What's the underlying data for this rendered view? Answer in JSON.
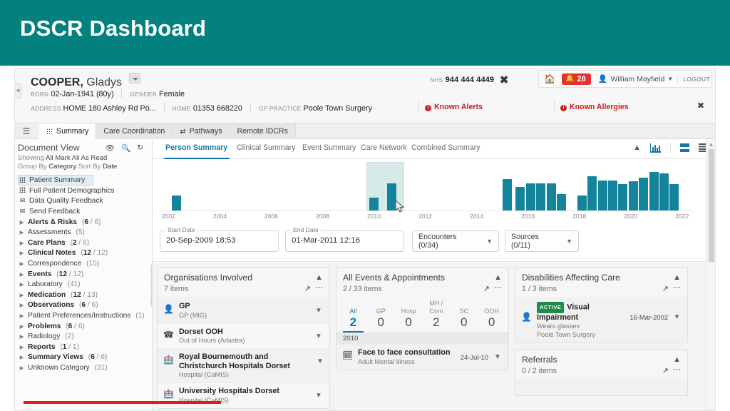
{
  "banner": {
    "title": "DSCR Dashboard",
    "bg": "#04817f"
  },
  "patient": {
    "surname": "COOPER,",
    "given": "Gladys",
    "born_label": "BORN",
    "born_value": "02-Jan-1941 (80y)",
    "gender_label": "GENDER",
    "gender_value": "Female",
    "address_label": "ADDRESS",
    "address_value": "HOME 180 Ashley Rd Po...",
    "home_label": "HOME",
    "home_value": "01353 668220",
    "gp_practice_label": "GP PRACTICE",
    "gp_practice_value": "Poole Town Surgery",
    "nhs_label": "NHS",
    "nhs_value": "944 444 4449",
    "known_alerts": "Known Alerts",
    "known_allergies": "Known Allergies",
    "alert_color": "#c9201a"
  },
  "account": {
    "alert_count": "28",
    "user_name": "William Mayfield",
    "logout": "LOGOUT",
    "alert_bg": "#e8312a"
  },
  "main_tabs": [
    {
      "label": "Summary",
      "icon": "grid-icon",
      "active": true
    },
    {
      "label": "Care Coordination",
      "icon": "",
      "active": false
    },
    {
      "label": "Pathways",
      "icon": "pathways-icon",
      "active": false
    },
    {
      "label": "Remote IDCRs",
      "icon": "",
      "active": false
    }
  ],
  "sidebar": {
    "title": "Document View",
    "icons": [
      "eye-icon",
      "search-icon",
      "refresh-icon"
    ],
    "showing_label": "Showing",
    "showing_value": "All",
    "mark_all": "Mark All As Read",
    "group_by_label": "Group By",
    "group_by_value": "Category",
    "sort_by_label": "Sort By",
    "sort_by_value": "Date",
    "items": [
      {
        "label": "Patient Summary",
        "icon": "grid-icon",
        "count": "",
        "bold": false,
        "selected": true
      },
      {
        "label": "Full Patient Demographics",
        "icon": "grid-icon",
        "count": "",
        "bold": false,
        "selected": false
      },
      {
        "label": "Data Quality Feedback",
        "icon": "envelope-icon",
        "count": "",
        "bold": false,
        "selected": false
      },
      {
        "label": "Send Feedback",
        "icon": "envelope-icon",
        "count": "",
        "bold": false,
        "selected": false
      },
      {
        "label": "Alerts & Risks",
        "icon": "triangle-icon",
        "count": "(6 / 6)",
        "unread": "6",
        "total": "6",
        "bold": true,
        "selected": false
      },
      {
        "label": "Assessments",
        "icon": "triangle-icon",
        "count": "(5)",
        "bold": false,
        "selected": false
      },
      {
        "label": "Care Plans",
        "icon": "triangle-icon",
        "count": "(2 / 6)",
        "unread": "2",
        "total": "6",
        "bold": true,
        "selected": false
      },
      {
        "label": "Clinical Notes",
        "icon": "triangle-icon",
        "count": "(12 / 12)",
        "unread": "12",
        "total": "12",
        "bold": true,
        "selected": false
      },
      {
        "label": "Correspondence",
        "icon": "triangle-icon",
        "count": "(15)",
        "bold": false,
        "selected": false
      },
      {
        "label": "Events",
        "icon": "triangle-icon",
        "count": "(12 / 12)",
        "unread": "12",
        "total": "12",
        "bold": true,
        "selected": false
      },
      {
        "label": "Laboratory",
        "icon": "triangle-icon",
        "count": "(41)",
        "bold": false,
        "selected": false
      },
      {
        "label": "Medication",
        "icon": "triangle-icon",
        "count": "(12 / 13)",
        "unread": "12",
        "total": "13",
        "bold": true,
        "selected": false
      },
      {
        "label": "Observations",
        "icon": "triangle-icon",
        "count": "(6 / 6)",
        "unread": "6",
        "total": "6",
        "bold": true,
        "selected": false
      },
      {
        "label": "Patient Preferences/Instructions",
        "icon": "triangle-icon",
        "count": "(1)",
        "bold": false,
        "selected": false
      },
      {
        "label": "Problems",
        "icon": "triangle-icon",
        "count": "(6 / 6)",
        "unread": "6",
        "total": "6",
        "bold": true,
        "selected": false
      },
      {
        "label": "Radiology",
        "icon": "triangle-icon",
        "count": "(2)",
        "bold": false,
        "selected": false
      },
      {
        "label": "Reports",
        "icon": "triangle-icon",
        "count": "(1 / 1)",
        "unread": "1",
        "total": "1",
        "bold": true,
        "selected": false
      },
      {
        "label": "Summary Views",
        "icon": "triangle-icon",
        "count": "(6 / 6)",
        "unread": "6",
        "total": "6",
        "bold": true,
        "selected": false
      },
      {
        "label": "Unknown Category",
        "icon": "triangle-icon",
        "count": "(31)",
        "bold": false,
        "selected": false
      }
    ]
  },
  "sub_tabs": [
    {
      "label": "Person Summary",
      "active": true
    },
    {
      "label": "Clinical Summary",
      "active": false
    },
    {
      "label": "Event Summary",
      "active": false
    },
    {
      "label": "Care Network",
      "active": false
    },
    {
      "label": "Combined Summary",
      "active": false
    }
  ],
  "sub_icons": [
    "chevron-up-icon",
    "bar-chart-icon",
    "split-view-icon",
    "list-view-icon"
  ],
  "filters": {
    "start_date_label": "Start Date",
    "start_date_value": "20-Sep-2009 18:53",
    "end_date_label": "End Date",
    "end_date_value": "01-Mar-2011 12:16",
    "encounters": "Encounters (0/34)",
    "sources": "Sources (0/11)"
  },
  "chart_data": {
    "type": "bar",
    "title": "",
    "xlabel": "",
    "ylabel": "",
    "xlim": [
      2001.6,
      2022.2
    ],
    "ylim": [
      0,
      10
    ],
    "grid": false,
    "legend": "none",
    "tick_labels": [
      "2002",
      "2004",
      "2006",
      "2008",
      "2010",
      "2012",
      "2014",
      "2016",
      "2018",
      "2020",
      "2022"
    ],
    "selection_band": {
      "from": 2009.72,
      "to": 2011.17,
      "color": "#cfe8e3"
    },
    "bar_color": "#13849b",
    "x": [
      2002.3,
      2010.0,
      2010.7,
      2015.2,
      2015.7,
      2016.1,
      2016.5,
      2016.9,
      2017.3,
      2018.1,
      2018.5,
      2018.9,
      2019.3,
      2019.7,
      2020.1,
      2020.5,
      2020.9,
      2021.3,
      2021.7
    ],
    "values": [
      3.1,
      2.7,
      5.6,
      6.4,
      4.9,
      5.6,
      5.6,
      5.6,
      3.4,
      3.1,
      7.1,
      6.2,
      6.2,
      5.4,
      6.1,
      6.7,
      8.0,
      7.6,
      5.4
    ]
  },
  "cards": {
    "organisations": {
      "title": "Organisations Involved",
      "subtitle": "7 items",
      "rows": [
        {
          "title": "GP",
          "sub": "GP (MIG)",
          "icon": "person-org-icon",
          "date": ""
        },
        {
          "title": "Dorset OOH",
          "sub": "Out of Hours (Adastra)",
          "icon": "phone-icon",
          "date": ""
        },
        {
          "title": "Royal Bournemouth and Christchurch Hospitals Dorset",
          "sub": "Hospital (CaMIS)",
          "icon": "hospital-icon",
          "date": ""
        },
        {
          "title": "University Hospitals Dorset",
          "sub": "Hospital (CaMIS)",
          "icon": "hospital-icon",
          "date": ""
        }
      ]
    },
    "events": {
      "title": "All Events & Appointments",
      "subtitle": "2 / 33 items",
      "counters": [
        {
          "label": "All",
          "value": "2",
          "selected": true
        },
        {
          "label": "GP",
          "value": "0",
          "selected": false
        },
        {
          "label": "Hosp",
          "value": "0",
          "selected": false
        },
        {
          "label": "MH / Com",
          "value": "2",
          "selected": false
        },
        {
          "label": "SC",
          "value": "0",
          "selected": false
        },
        {
          "label": "OOH",
          "value": "0",
          "selected": false
        }
      ],
      "year_band": "2010",
      "rows": [
        {
          "title": "Face to face consultation",
          "sub": "Adult Mental Illness",
          "icon": "calendar-icon",
          "date": "24-Jul-10"
        }
      ]
    },
    "disabilities": {
      "title": "Disabilities Affecting Care",
      "subtitle": "1 / 3 items",
      "rows": [
        {
          "badge": "ACTIVE",
          "badge_color": "#1e8a4c",
          "title": "Visual Impairment",
          "sub": "Wears glasses",
          "sub2": "Poole Town Surgery",
          "icon": "person-org-icon",
          "date": "16-Mar-2002"
        }
      ]
    },
    "referrals": {
      "title": "Referrals",
      "subtitle": "0 / 2 items",
      "rows": []
    }
  },
  "annotation": {
    "underline_color": "#e41b17"
  }
}
